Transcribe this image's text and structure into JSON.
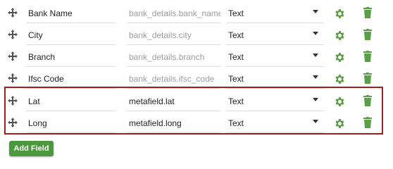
{
  "fields": [
    {
      "name": "Bank Name",
      "key": "bank_details.bank_name",
      "key_is_placeholder": true,
      "type": "Text"
    },
    {
      "name": "City",
      "key": "bank_details.city",
      "key_is_placeholder": true,
      "type": "Text"
    },
    {
      "name": "Branch",
      "key": "bank_details.branch",
      "key_is_placeholder": true,
      "type": "Text"
    },
    {
      "name": "Ifsc Code",
      "key": "bank_details.ifsc_code",
      "key_is_placeholder": true,
      "type": "Text"
    },
    {
      "name": "Lat",
      "key": "metafield.lat",
      "key_is_placeholder": false,
      "type": "Text"
    },
    {
      "name": "Long",
      "key": "metafield.long",
      "key_is_placeholder": false,
      "type": "Text"
    }
  ],
  "icons": {
    "drag": "drag-handle-icon",
    "settings": "gear-icon",
    "delete": "trash-icon"
  },
  "colors": {
    "icon_green": "#5a9e45",
    "button_green": "#4a9a3d",
    "highlight_red": "#a31e1e"
  },
  "add_button_label": "Add Field"
}
